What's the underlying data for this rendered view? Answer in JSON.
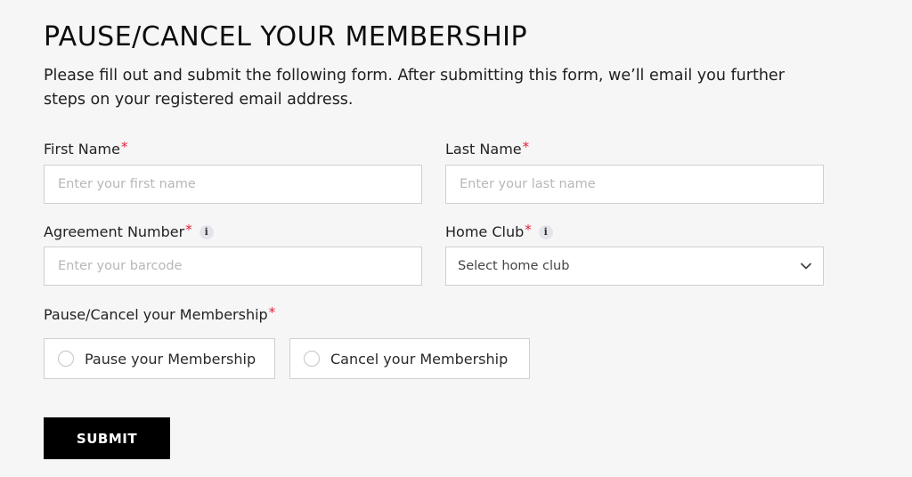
{
  "header": {
    "title": "PAUSE/CANCEL YOUR MEMBERSHIP",
    "intro": "Please fill out and submit the following form. After submitting this form, we’ll email you further steps on your registered email address."
  },
  "form": {
    "required_marker": "*",
    "first_name": {
      "label": "First Name",
      "placeholder": "Enter your first name",
      "value": ""
    },
    "last_name": {
      "label": "Last Name",
      "placeholder": "Enter your last name",
      "value": ""
    },
    "agreement_number": {
      "label": "Agreement Number",
      "placeholder": "Enter your barcode",
      "value": "",
      "info_icon": "info-icon"
    },
    "home_club": {
      "label": "Home Club",
      "selected": "Select home club",
      "info_icon": "info-icon",
      "dropdown_icon": "chevron-down-icon"
    },
    "membership_action": {
      "label": "Pause/Cancel your Membership",
      "options": [
        {
          "label": "Pause your Membership",
          "checked": false
        },
        {
          "label": "Cancel your Membership",
          "checked": false
        }
      ]
    },
    "submit_label": "SUBMIT"
  },
  "colors": {
    "background": "#f6f6f6",
    "required": "#e0213b",
    "button_bg": "#000000",
    "button_text": "#ffffff",
    "border": "#cfcfcf"
  }
}
